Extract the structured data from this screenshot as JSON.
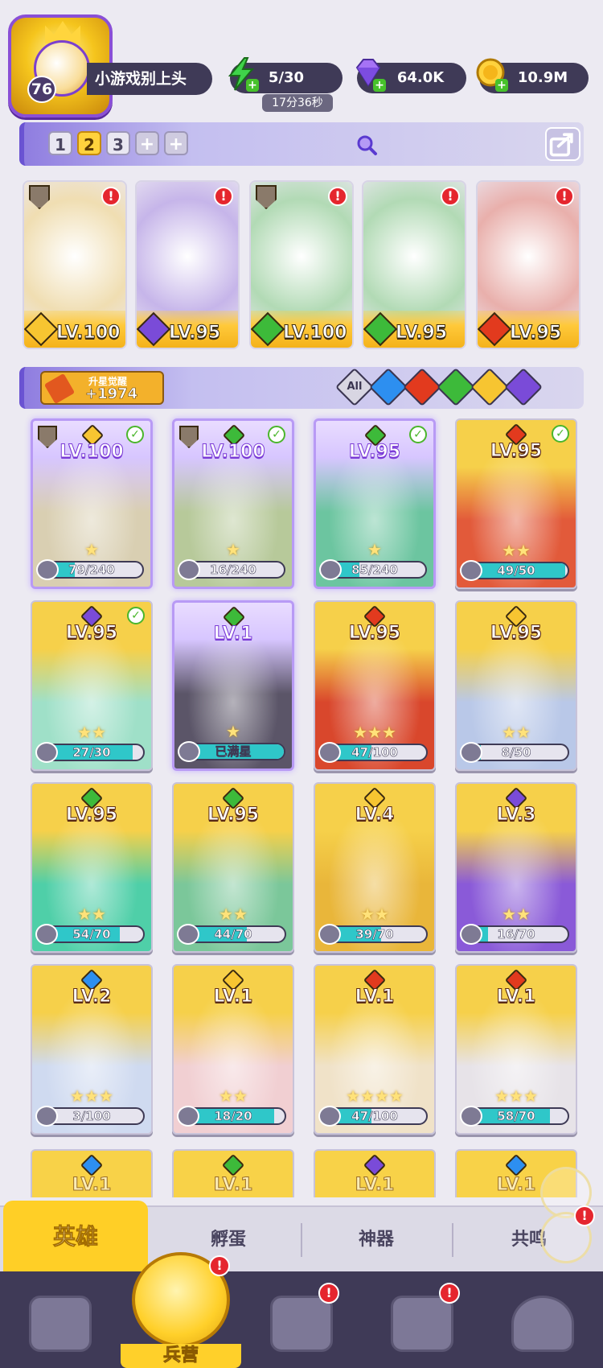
{
  "player": {
    "level": "76",
    "name": "小游戏别上头"
  },
  "resources": {
    "energy": "5/30",
    "energy_timer": "17分36秒",
    "gems": "64.0K",
    "gold": "10.9M"
  },
  "team": {
    "tabs": [
      "1",
      "2",
      "3",
      "+",
      "+"
    ],
    "active_tab": "2"
  },
  "lineup": [
    {
      "level": "LV.100",
      "element": "gold",
      "color": "#f7c531",
      "shield": true,
      "alert": "!"
    },
    {
      "level": "LV.95",
      "element": "purple",
      "color": "#7a4bd8",
      "shield": false,
      "alert": "!"
    },
    {
      "level": "LV.100",
      "element": "green",
      "color": "#3dba3a",
      "shield": true,
      "alert": "!"
    },
    {
      "level": "LV.95",
      "element": "green",
      "color": "#3dba3a",
      "shield": false,
      "alert": "!"
    },
    {
      "level": "LV.95",
      "element": "fire",
      "color": "#e23a1e",
      "shield": false,
      "alert": "!"
    }
  ],
  "awaken": {
    "label": "升星觉醒",
    "value": "+1974"
  },
  "filters": [
    {
      "name": "All",
      "color": "#d8d6e2"
    },
    {
      "name": "water",
      "color": "#2d8ff0"
    },
    {
      "name": "fire",
      "color": "#e23a1e"
    },
    {
      "name": "wood",
      "color": "#3dba3a"
    },
    {
      "name": "light",
      "color": "#f7c531"
    },
    {
      "name": "dark",
      "color": "#7a4bd8"
    }
  ],
  "heroes": [
    {
      "level": "LV.100",
      "element_color": "#f7c531",
      "progress": "79/240",
      "fill": 0.33,
      "stars": "★",
      "check": true,
      "shield": true,
      "purple": true,
      "bg": "#d9cfb2"
    },
    {
      "level": "LV.100",
      "element_color": "#3dba3a",
      "progress": "16/240",
      "fill": 0.07,
      "stars": "★",
      "check": true,
      "shield": true,
      "purple": true,
      "bg": "#b7c99a"
    },
    {
      "level": "LV.95",
      "element_color": "#3dba3a",
      "progress": "85/240",
      "fill": 0.35,
      "stars": "★",
      "check": true,
      "shield": false,
      "purple": true,
      "bg": "#6cc5a0"
    },
    {
      "level": "LV.95",
      "element_color": "#e23a1e",
      "progress": "49/50",
      "fill": 0.98,
      "stars": "★★",
      "check": true,
      "shield": false,
      "purple": false,
      "bg": "#e25a3a"
    },
    {
      "level": "LV.95",
      "element_color": "#7a4bd8",
      "progress": "27/30",
      "fill": 0.9,
      "stars": "★★",
      "check": true,
      "shield": false,
      "purple": false,
      "bg": "#9fe0c8"
    },
    {
      "level": "LV.1",
      "element_color": "#3dba3a",
      "progress": "已满星",
      "fill": 1.0,
      "stars": "★",
      "check": false,
      "shield": false,
      "purple": true,
      "bg": "#5b5568"
    },
    {
      "level": "LV.95",
      "element_color": "#e23a1e",
      "progress": "47/100",
      "fill": 0.47,
      "stars": "★★★",
      "check": false,
      "shield": false,
      "purple": false,
      "bg": "#d9472c"
    },
    {
      "level": "LV.95",
      "element_color": "#f7c531",
      "progress": "8/50",
      "fill": 0.16,
      "stars": "★★",
      "check": false,
      "shield": false,
      "purple": false,
      "bg": "#b9c8e8"
    },
    {
      "level": "LV.95",
      "element_color": "#3dba3a",
      "progress": "54/70",
      "fill": 0.77,
      "stars": "★★",
      "check": false,
      "shield": false,
      "purple": false,
      "bg": "#4fcfa8"
    },
    {
      "level": "LV.95",
      "element_color": "#3dba3a",
      "progress": "44/70",
      "fill": 0.63,
      "stars": "★★",
      "check": false,
      "shield": false,
      "purple": false,
      "bg": "#7bc79a"
    },
    {
      "level": "LV.4",
      "element_color": "#f7c531",
      "progress": "39/70",
      "fill": 0.56,
      "stars": "★★",
      "check": false,
      "shield": false,
      "purple": false,
      "bg": "#e9b63a"
    },
    {
      "level": "LV.3",
      "element_color": "#7a4bd8",
      "progress": "16/70",
      "fill": 0.23,
      "stars": "★★",
      "check": false,
      "shield": false,
      "purple": false,
      "bg": "#8a5ad8"
    },
    {
      "level": "LV.2",
      "element_color": "#2d8ff0",
      "progress": "3/100",
      "fill": 0.03,
      "stars": "★★★",
      "check": false,
      "shield": false,
      "purple": false,
      "bg": "#cfdaf0"
    },
    {
      "level": "LV.1",
      "element_color": "#f7c531",
      "progress": "18/20",
      "fill": 0.9,
      "stars": "★★",
      "check": false,
      "shield": false,
      "purple": false,
      "bg": "#f1cfd2"
    },
    {
      "level": "LV.1",
      "element_color": "#e23a1e",
      "progress": "47/100",
      "fill": 0.47,
      "stars": "★★★★",
      "check": false,
      "shield": false,
      "purple": false,
      "bg": "#f0e2c8"
    },
    {
      "level": "LV.1",
      "element_color": "#e23a1e",
      "progress": "58/70",
      "fill": 0.83,
      "stars": "★★★",
      "check": false,
      "shield": false,
      "purple": false,
      "bg": "#e7e3e8"
    }
  ],
  "partial_heroes": [
    {
      "level": "LV.1",
      "element_color": "#2d8ff0"
    },
    {
      "level": "LV.1",
      "element_color": "#3dba3a"
    },
    {
      "level": "LV.1",
      "element_color": "#7a4bd8"
    },
    {
      "level": "LV.1",
      "element_color": "#2d8ff0"
    }
  ],
  "subtabs": [
    "英雄",
    "孵蛋",
    "神器",
    "共鸣"
  ],
  "floating_alert": "!",
  "nav": {
    "items": [
      {
        "name": "cards",
        "alert": ""
      },
      {
        "name": "barracks",
        "label": "兵营",
        "alert": "!"
      },
      {
        "name": "map",
        "alert": "!"
      },
      {
        "name": "temple",
        "alert": "!"
      },
      {
        "name": "mushroom",
        "alert": ""
      }
    ]
  }
}
